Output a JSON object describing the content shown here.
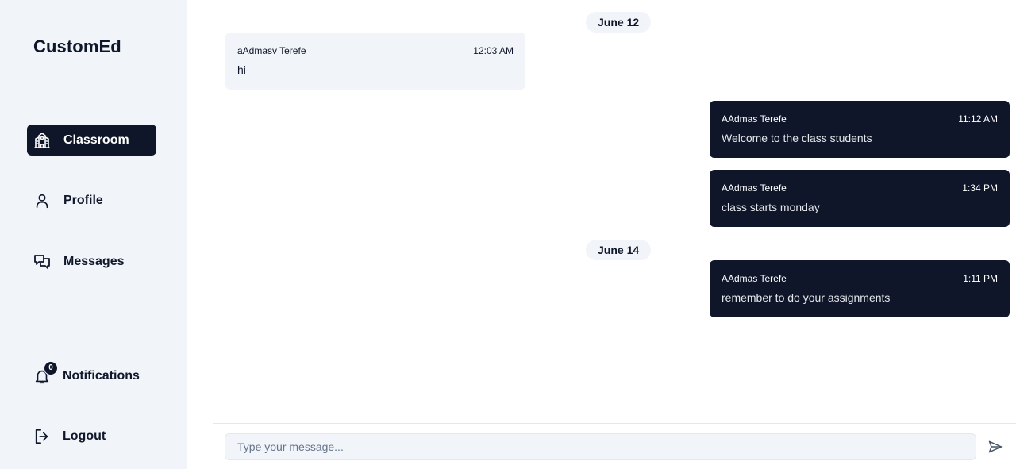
{
  "app": {
    "brand": "CustomEd"
  },
  "sidebar": {
    "items": [
      {
        "label": "Classroom",
        "icon": "school-icon",
        "active": true
      },
      {
        "label": "Profile",
        "icon": "user-icon",
        "active": false
      },
      {
        "label": "Messages",
        "icon": "messages-icon",
        "active": false
      }
    ],
    "notifications": {
      "label": "Notifications",
      "icon": "bell-icon",
      "count": "0"
    },
    "logout": {
      "label": "Logout",
      "icon": "logout-icon"
    }
  },
  "chat": {
    "groups": [
      {
        "date": "June 12",
        "messages": [
          {
            "sender": "aAdmasv Terefe",
            "time": "12:03 AM",
            "text": "hi",
            "direction": "incoming"
          },
          {
            "sender": "AAdmas Terefe",
            "time": "11:12 AM",
            "text": "Welcome to the class students",
            "direction": "outgoing"
          },
          {
            "sender": "AAdmas Terefe",
            "time": "1:34 PM",
            "text": "class starts monday",
            "direction": "outgoing"
          }
        ]
      },
      {
        "date": "June 14",
        "messages": [
          {
            "sender": "AAdmas Terefe",
            "time": "1:11 PM",
            "text": "remember to do your assignments",
            "direction": "outgoing"
          }
        ]
      }
    ],
    "composer": {
      "placeholder": "Type your message...",
      "value": "",
      "send_icon": "send-icon"
    }
  },
  "colors": {
    "sidebar_bg": "#f1f4f9",
    "accent_dark": "#0f1629",
    "bubble_in": "#f1f4f9"
  }
}
